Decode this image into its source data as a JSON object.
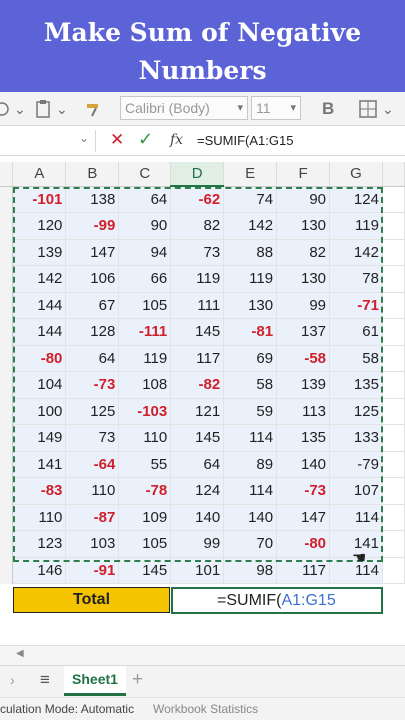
{
  "banner": {
    "line1": "Make Sum of Negative",
    "line2": "Numbers"
  },
  "ribbon": {
    "font_name": "Calibri (Body)",
    "font_size": "11",
    "bold_label": "B"
  },
  "formula_bar": {
    "cancel": "✕",
    "enter": "✓",
    "fx": "fx",
    "formula": "=SUMIF(A1:G15"
  },
  "columns": [
    "A",
    "B",
    "C",
    "D",
    "E",
    "F",
    "G"
  ],
  "selected_column": "D",
  "rows": [
    [
      "-101",
      "138",
      "64",
      "-62",
      "74",
      "90",
      "124"
    ],
    [
      "120",
      "-99",
      "90",
      "82",
      "142",
      "130",
      "119"
    ],
    [
      "139",
      "147",
      "94",
      "73",
      "88",
      "82",
      "142"
    ],
    [
      "142",
      "106",
      "66",
      "119",
      "119",
      "130",
      "78"
    ],
    [
      "144",
      "67",
      "105",
      "111",
      "130",
      "99",
      "-71"
    ],
    [
      "144",
      "128",
      "-111",
      "145",
      "-81",
      "137",
      "61"
    ],
    [
      "-80",
      "64",
      "119",
      "117",
      "69",
      "-58",
      "58"
    ],
    [
      "104",
      "-73",
      "108",
      "-82",
      "58",
      "139",
      "135"
    ],
    [
      "100",
      "125",
      "-103",
      "121",
      "59",
      "113",
      "125"
    ],
    [
      "149",
      "73",
      "110",
      "145",
      "114",
      "135",
      "133"
    ],
    [
      "141",
      "-64",
      "55",
      "64",
      "89",
      "140",
      "-79"
    ],
    [
      "-83",
      "110",
      "-78",
      "124",
      "114",
      "-73",
      "107"
    ],
    [
      "110",
      "-87",
      "109",
      "140",
      "140",
      "147",
      "114"
    ],
    [
      "123",
      "103",
      "105",
      "99",
      "70",
      "-80",
      "141"
    ],
    [
      "146",
      "-91",
      "145",
      "101",
      "98",
      "117",
      "114"
    ]
  ],
  "total": {
    "label": "Total",
    "formula_prefix": "=SUMIF(",
    "formula_ref": "A1:G15"
  },
  "sheet_tabs": {
    "active": "Sheet1",
    "add": "+"
  },
  "status": {
    "mode": "culation Mode: Automatic",
    "stats": "Workbook Statistics"
  },
  "colors": {
    "banner": "#5b63d6",
    "total_fill": "#f5c400",
    "negative": "#d0202a",
    "excel_green": "#217346"
  }
}
